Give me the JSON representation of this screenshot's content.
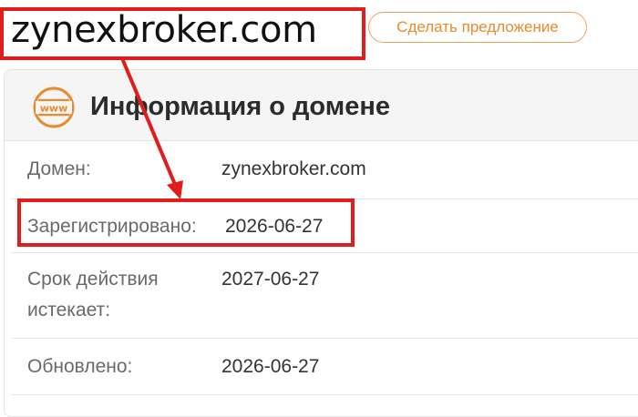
{
  "domain": "zynexbroker.com",
  "offer_button": "Сделать предложение",
  "card": {
    "icon": "www-icon",
    "icon_text": "www",
    "title": "Информация о домене"
  },
  "rows": [
    {
      "label": "Домен:",
      "value": "zynexbroker.com"
    },
    {
      "label": "Зарегистрировано:",
      "value": "2026-06-27"
    },
    {
      "label": "Срок действия истекает:",
      "value": "2027-06-27"
    },
    {
      "label": "Обновлено:",
      "value": "2026-06-27"
    }
  ],
  "colors": {
    "accent": "#e98a2f",
    "annotation": "#e21b1b"
  }
}
